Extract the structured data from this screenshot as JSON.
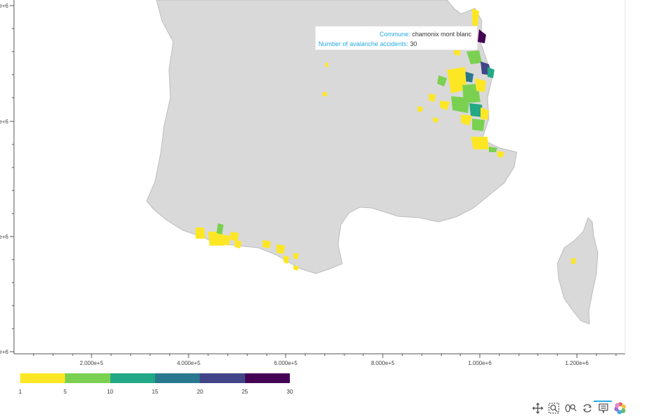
{
  "map": {
    "x_axis_ticks": [
      "2.000e+5",
      "4.000e+5",
      "6.000e+5",
      "8.000e+5",
      "1.000e+6",
      "1.200e+6"
    ],
    "y_axis_ticks": [
      "e+6",
      "e+6",
      "e+6",
      "e+6"
    ],
    "base_color": "#d9d9d9",
    "border_color": "#bdbdbd"
  },
  "tooltip": {
    "commune_key": "Commune:",
    "commune_value": "chamonix mont blanc",
    "accidents_key": "Number of avalanche accidents:",
    "accidents_value": "30"
  },
  "colorbar": {
    "colors": [
      "#fde725",
      "#7ad151",
      "#22a884",
      "#2a788e",
      "#414487",
      "#440154"
    ],
    "ticks": [
      "1",
      "5",
      "10",
      "15",
      "20",
      "25",
      "30"
    ]
  },
  "toolbar": {
    "tools": [
      "pan-icon",
      "box-zoom-icon",
      "wheel-zoom-icon",
      "reset-icon",
      "hover-icon",
      "bokeh-logo-icon"
    ]
  }
}
